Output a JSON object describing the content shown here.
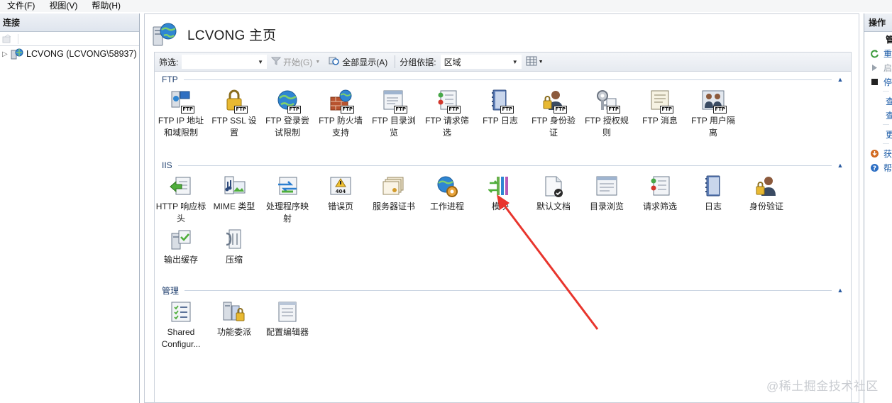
{
  "menu": [
    "文件(F)",
    "视图(V)",
    "帮助(H)"
  ],
  "connections": {
    "title": "连接",
    "tree_item": "LCVONG (LCVONG\\58937)"
  },
  "page": {
    "title": "LCVONG 主页"
  },
  "filterbar": {
    "filter_label": "筛选:",
    "filter_value": "",
    "start_label": "开始(G)",
    "show_all_label": "全部显示(A)",
    "group_by_label": "分组依据:",
    "group_by_value": "区域"
  },
  "groups": {
    "ftp": {
      "name": "FTP",
      "items": [
        {
          "line1": "FTP IP 地址",
          "line2": "和域限制",
          "icon": "ftp-ip-restrictions-icon"
        },
        {
          "line1": "FTP SSL 设",
          "line2": "置",
          "icon": "ftp-ssl-icon"
        },
        {
          "line1": "FTP 登录尝",
          "line2": "试限制",
          "icon": "ftp-logon-attempts-icon"
        },
        {
          "line1": "FTP 防火墙",
          "line2": "支持",
          "icon": "ftp-firewall-icon"
        },
        {
          "line1": "FTP 目录浏",
          "line2": "览",
          "icon": "ftp-directory-browsing-icon"
        },
        {
          "line1": "FTP 请求筛",
          "line2": "选",
          "icon": "ftp-request-filtering-icon"
        },
        {
          "line1": "FTP 日志",
          "line2": "",
          "icon": "ftp-logging-icon"
        },
        {
          "line1": "FTP 身份验",
          "line2": "证",
          "icon": "ftp-authentication-icon"
        },
        {
          "line1": "FTP 授权规",
          "line2": "则",
          "icon": "ftp-authorization-icon"
        },
        {
          "line1": "FTP 消息",
          "line2": "",
          "icon": "ftp-messages-icon"
        },
        {
          "line1": "FTP 用户隔",
          "line2": "离",
          "icon": "ftp-user-isolation-icon"
        }
      ]
    },
    "iis": {
      "name": "IIS",
      "items": [
        {
          "line1": "HTTP 响应标",
          "line2": "头",
          "icon": "http-response-headers-icon"
        },
        {
          "line1": "MIME 类型",
          "line2": "",
          "icon": "mime-types-icon"
        },
        {
          "line1": "处理程序映",
          "line2": "射",
          "icon": "handler-mappings-icon"
        },
        {
          "line1": "错误页",
          "line2": "",
          "icon": "error-pages-icon"
        },
        {
          "line1": "服务器证书",
          "line2": "",
          "icon": "server-certificates-icon"
        },
        {
          "line1": "工作进程",
          "line2": "",
          "icon": "worker-processes-icon"
        },
        {
          "line1": "模块",
          "line2": "",
          "icon": "modules-icon"
        },
        {
          "line1": "默认文档",
          "line2": "",
          "icon": "default-document-icon"
        },
        {
          "line1": "目录浏览",
          "line2": "",
          "icon": "directory-browsing-icon"
        },
        {
          "line1": "请求筛选",
          "line2": "",
          "icon": "request-filtering-icon"
        },
        {
          "line1": "日志",
          "line2": "",
          "icon": "logging-icon"
        },
        {
          "line1": "身份验证",
          "line2": "",
          "icon": "authentication-icon"
        },
        {
          "line1": "输出缓存",
          "line2": "",
          "icon": "output-caching-icon"
        },
        {
          "line1": "压缩",
          "line2": "",
          "icon": "compression-icon"
        }
      ]
    },
    "management": {
      "name": "管理",
      "items": [
        {
          "line1": "Shared",
          "line2": "Configur...",
          "icon": "shared-configuration-icon"
        },
        {
          "line1": "功能委派",
          "line2": "",
          "icon": "feature-delegation-icon"
        },
        {
          "line1": "配置编辑器",
          "line2": "",
          "icon": "configuration-editor-icon"
        }
      ]
    }
  },
  "actions": {
    "title": "操作",
    "items": [
      "管",
      "重",
      "启",
      "停",
      "查",
      "查",
      "更",
      "获",
      "帮"
    ]
  },
  "annotation_color": "#e8352d",
  "watermark": "@稀土掘金技术社区"
}
